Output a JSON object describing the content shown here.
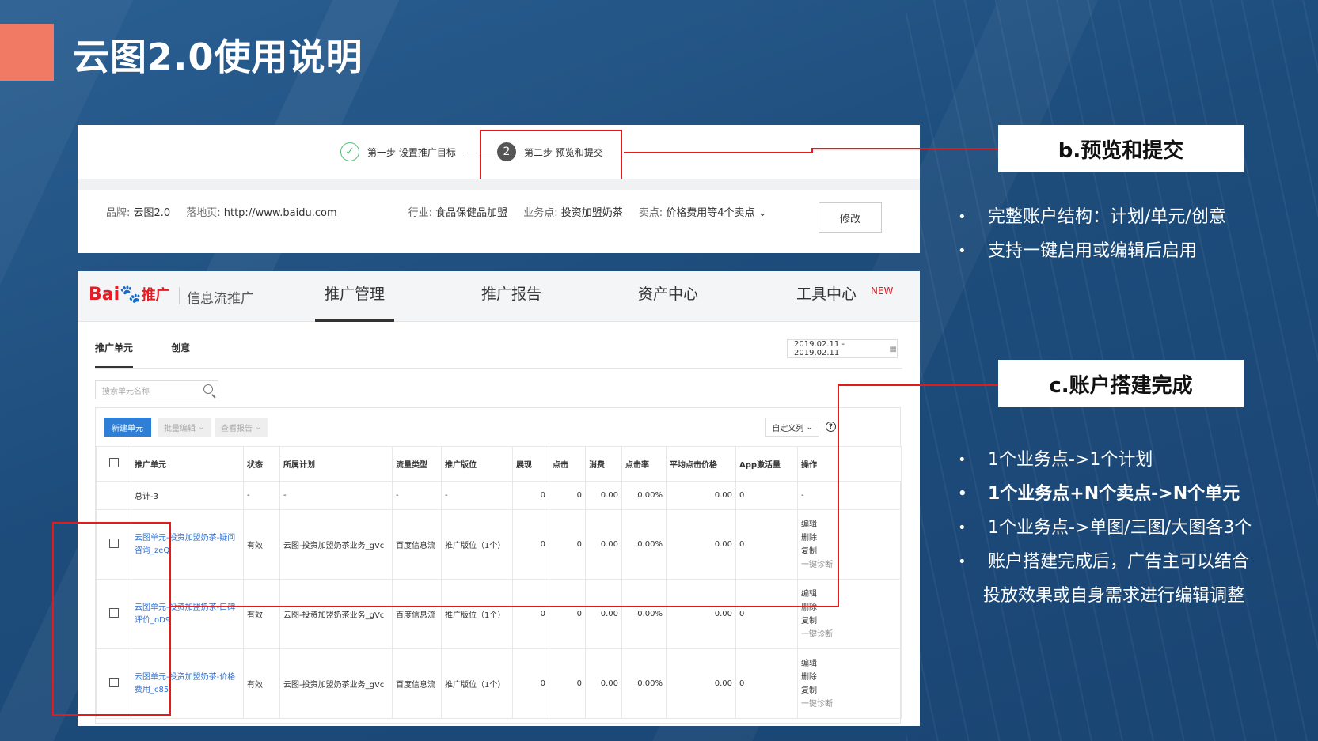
{
  "slide": {
    "title": "云图2.0使用说明",
    "accent_color": "#f07a63",
    "highlight_color": "#e21b1b"
  },
  "steps": {
    "step1_label": "第一步 设置推广目标",
    "step1_icon": "check-icon",
    "step2_num": "2",
    "step2_label": "第二步 预览和提交"
  },
  "info": {
    "brand_label": "品牌:",
    "brand_value": "云图2.0",
    "landing_label": "落地页:",
    "landing_value": "http://www.baidu.com",
    "industry_label": "行业:",
    "industry_value": "食品保健品加盟",
    "business_label": "业务点:",
    "business_value": "投资加盟奶茶",
    "selling_label": "卖点:",
    "selling_value": "价格费用等4个卖点",
    "modify_button": "修改"
  },
  "topnav": {
    "logo_bai": "Bai",
    "logo_du": "du",
    "logo_tg": "推广",
    "product": "信息流推广",
    "items": [
      "推广管理",
      "推广报告",
      "资产中心",
      "工具中心"
    ],
    "new_badge": "NEW"
  },
  "subtabs": [
    "推广单元",
    "创意"
  ],
  "date_range": "2019.02.11 - 2019.02.11",
  "search_placeholder": "搜索单元名称",
  "toolbar": {
    "new_unit": "新建单元",
    "batch_edit": "批量编辑",
    "view_report": "查看报告",
    "custom_columns": "自定义列",
    "help": "?"
  },
  "table": {
    "headers": [
      "推广单元",
      "状态",
      "所属计划",
      "流量类型",
      "推广版位",
      "展现",
      "点击",
      "消费",
      "点击率",
      "平均点击价格",
      "App激活量",
      "操作"
    ],
    "total": {
      "name": "总计-3",
      "status": "-",
      "plan": "-",
      "traffic": "-",
      "placement": "-",
      "impressions": "0",
      "clicks": "0",
      "cost": "0.00",
      "ctr": "0.00%",
      "cpc": "0.00",
      "app": "0",
      "ops": "-"
    },
    "rows": [
      {
        "name": "云图单元-投资加盟奶茶-疑问咨询_zeQ",
        "status": "有效",
        "plan": "云图-投资加盟奶茶业务_gVc",
        "traffic": "百度信息流",
        "placement": "推广版位（1个）",
        "impressions": "0",
        "clicks": "0",
        "cost": "0.00",
        "ctr": "0.00%",
        "cpc": "0.00",
        "app": "0"
      },
      {
        "name": "云图单元-投资加盟奶茶-口碑评价_oD9",
        "status": "有效",
        "plan": "云图-投资加盟奶茶业务_gVc",
        "traffic": "百度信息流",
        "placement": "推广版位（1个）",
        "impressions": "0",
        "clicks": "0",
        "cost": "0.00",
        "ctr": "0.00%",
        "cpc": "0.00",
        "app": "0"
      },
      {
        "name": "云图单元-投资加盟奶茶-价格费用_c85",
        "status": "有效",
        "plan": "云图-投资加盟奶茶业务_gVc",
        "traffic": "百度信息流",
        "placement": "推广版位（1个）",
        "impressions": "0",
        "clicks": "0",
        "cost": "0.00",
        "ctr": "0.00%",
        "cpc": "0.00",
        "app": "0"
      }
    ],
    "ops": {
      "edit": "编辑",
      "delete": "删除",
      "copy": "复制",
      "diagnose": "一键诊断"
    }
  },
  "callouts": {
    "b_title": "b.预览和提交",
    "b_bullets": [
      "完整账户结构：计划/单元/创意",
      "支持一键启用或编辑后启用"
    ],
    "c_title": "c.账户搭建完成",
    "c_bullets": [
      "1个业务点->1个计划",
      "1个业务点+N个卖点->N个单元",
      "1个业务点->单图/三图/大图各3个",
      "账户搭建完成后，广告主可以结合",
      "投放效果或自身需求进行编辑调整"
    ]
  }
}
